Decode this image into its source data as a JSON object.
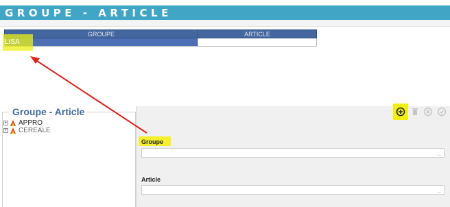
{
  "header": {
    "title": "GROUPE - ARTICLE"
  },
  "grid": {
    "columns": [
      "GROUPE",
      "ARTICLE"
    ],
    "rows": [
      {
        "groupe": "LISA",
        "article": ""
      }
    ]
  },
  "panel": {
    "legend": "Groupe - Article",
    "tree": [
      {
        "label": "APPRO",
        "icon": "flame-icon"
      },
      {
        "label": "CEREALE",
        "icon": "flame-icon"
      }
    ]
  },
  "toolbar": {
    "icons": [
      "add-icon",
      "delete-icon",
      "cancel-icon",
      "validate-icon"
    ]
  },
  "form": {
    "groupe_label": "Groupe",
    "groupe_value": "",
    "article_label": "Article",
    "article_value": "",
    "browse": "..."
  },
  "colors": {
    "title_bar": "#41a6c6",
    "header": "#44679f",
    "selected": "#4f6fb4",
    "highlight": "#f2ee10",
    "annotation_arrow": "#e0201a"
  }
}
